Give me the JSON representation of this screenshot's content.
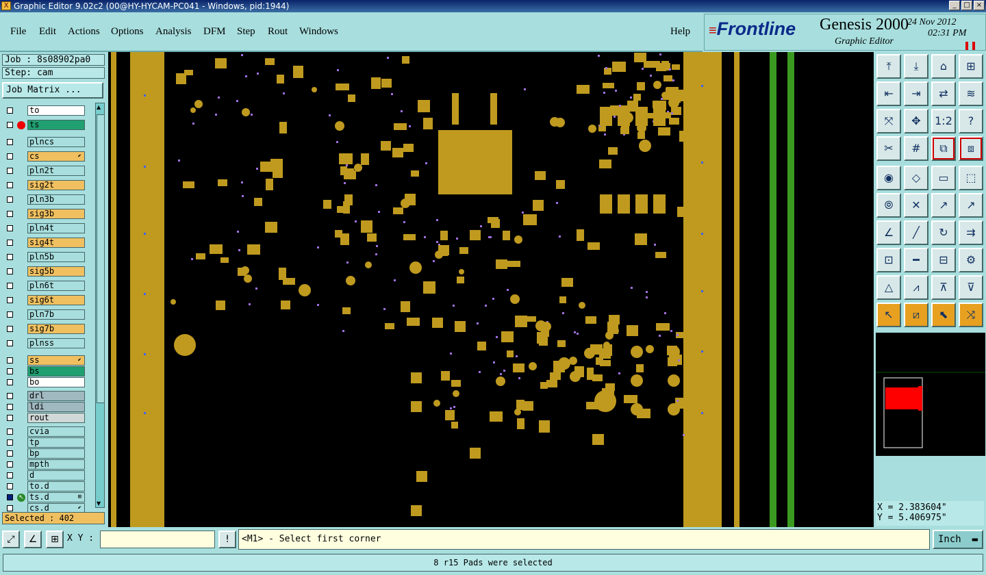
{
  "window": {
    "title": "Graphic Editor 9.02c2 (00@HY-HYCAM-PC041 - Windows, pid:1944)"
  },
  "menu": [
    "File",
    "Edit",
    "Actions",
    "Options",
    "Analysis",
    "DFM",
    "Step",
    "Rout",
    "Windows"
  ],
  "help": "Help",
  "brand": {
    "logo": "Frontline",
    "product": "Genesis 2000",
    "subtitle": "Graphic Editor",
    "date": "24 Nov 2012",
    "time": "02:31 PM"
  },
  "job": "Job : 8s08902pa0",
  "step": "Step: cam",
  "job_matrix": "Job Matrix ...",
  "layers": [
    {
      "name": "to",
      "color": "#ffffff"
    },
    {
      "name": "ts",
      "color": "#20a070",
      "marker": "red-dot"
    },
    {
      "name": "plncs",
      "color": "#a8dede"
    },
    {
      "name": "cs",
      "color": "#f0c060",
      "mark": "⬋"
    },
    {
      "name": "pln2t",
      "color": "#a8dede"
    },
    {
      "name": "sig2t",
      "color": "#f0c060"
    },
    {
      "name": "pln3b",
      "color": "#a8dede"
    },
    {
      "name": "sig3b",
      "color": "#f0c060"
    },
    {
      "name": "pln4t",
      "color": "#a8dede"
    },
    {
      "name": "sig4t",
      "color": "#f0c060"
    },
    {
      "name": "pln5b",
      "color": "#a8dede"
    },
    {
      "name": "sig5b",
      "color": "#f0c060"
    },
    {
      "name": "pln6t",
      "color": "#a8dede"
    },
    {
      "name": "sig6t",
      "color": "#f0c060"
    },
    {
      "name": "pln7b",
      "color": "#a8dede"
    },
    {
      "name": "sig7b",
      "color": "#f0c060"
    },
    {
      "name": "plnss",
      "color": "#a8dede"
    },
    {
      "name": "ss",
      "color": "#f0c060",
      "mark": "⬋"
    },
    {
      "name": "bs",
      "color": "#20a070"
    },
    {
      "name": "bo",
      "color": "#ffffff"
    },
    {
      "name": "drl",
      "color": "#a0b8c0"
    },
    {
      "name": "ldi",
      "color": "#a0b8c0"
    },
    {
      "name": "rout",
      "color": "#d0d8d8"
    },
    {
      "name": "cvia",
      "color": "#a8dede"
    },
    {
      "name": "tp",
      "color": "#a8dede"
    },
    {
      "name": "bp",
      "color": "#a8dede"
    },
    {
      "name": "mpth",
      "color": "#a8dede"
    },
    {
      "name": "d",
      "color": "#a8dede"
    },
    {
      "name": "to.d",
      "color": "#a8dede"
    },
    {
      "name": "ts.d",
      "color": "#a8dede",
      "marker": "arrow",
      "selected": true,
      "mark": "⊞"
    },
    {
      "name": "cs.d",
      "color": "#a8dede",
      "mark": "⬋"
    }
  ],
  "selected": "Selected : 402",
  "coords": {
    "x": "X = 2.383604\"",
    "y": "Y = 5.406975\""
  },
  "xy_label": "X Y :",
  "prompt": "<M1> - Select first corner",
  "unit": "Inch",
  "status": "8 r15 Pads were selected",
  "colors": {
    "copper": "#bf9a1f",
    "board": "#000000",
    "panel": "#a8dede",
    "via": "#a070e0",
    "green": "#3a9a20"
  }
}
